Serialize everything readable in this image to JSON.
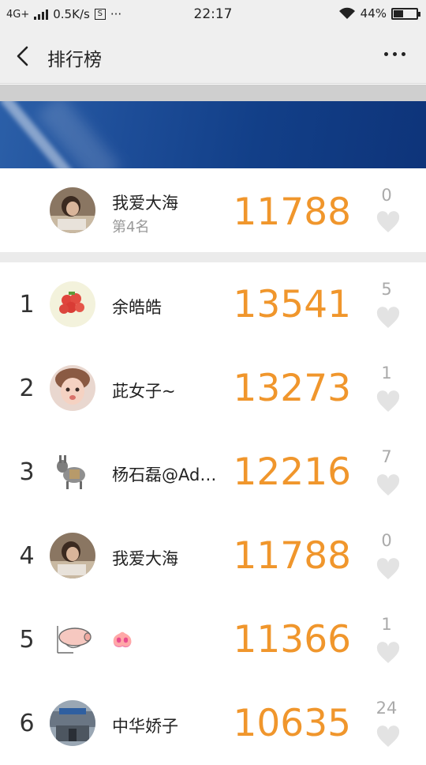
{
  "status": {
    "network": "4G+",
    "speed": "0.5K/s",
    "s_box": "S",
    "dots": "···",
    "time": "22:17",
    "battery": "44%",
    "battery_level": 0.44
  },
  "nav": {
    "title": "排行榜"
  },
  "me": {
    "name": "我爱大海",
    "rank_text": "第4名",
    "score": "11788",
    "likes": "0"
  },
  "ranking": [
    {
      "rank": "1",
      "name": "余皓皓",
      "score": "13541",
      "likes": "5",
      "avatar": "strawberry"
    },
    {
      "rank": "2",
      "name": "茈女子~",
      "score": "13273",
      "likes": "1",
      "avatar": "child"
    },
    {
      "rank": "3",
      "name": "杨石磊@Ad…",
      "score": "12216",
      "likes": "7",
      "avatar": "donkey"
    },
    {
      "rank": "4",
      "name": "我爱大海",
      "score": "11788",
      "likes": "0",
      "avatar": "person"
    },
    {
      "rank": "5",
      "name": "🐽",
      "score": "11366",
      "likes": "1",
      "avatar": "pig"
    },
    {
      "rank": "6",
      "name": "中华娇子",
      "score": "10635",
      "likes": "24",
      "avatar": "building"
    }
  ],
  "colors": {
    "score": "#f0962c",
    "banner": "#123f88"
  }
}
